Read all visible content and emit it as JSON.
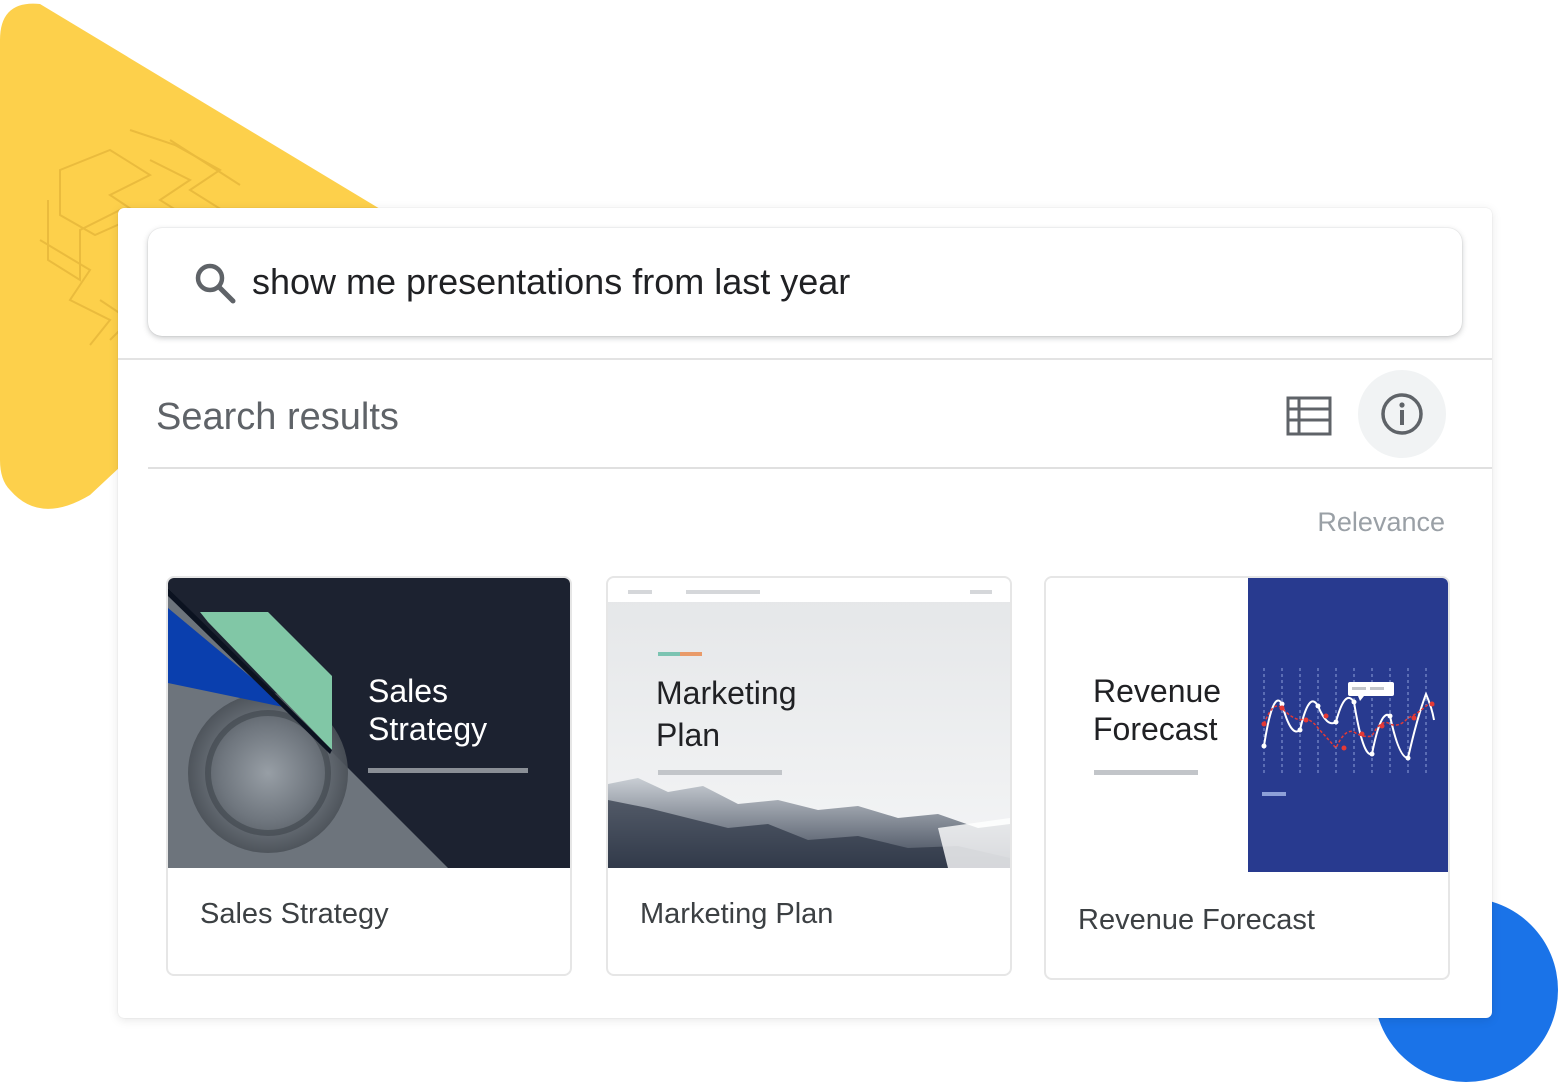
{
  "search": {
    "query": "show me presentations from last year",
    "icon": "search-icon"
  },
  "results": {
    "title": "Search results",
    "sort_label": "Relevance",
    "list_view_icon": "list-view-icon",
    "info_icon": "info-icon"
  },
  "cards": [
    {
      "title": "Sales Strategy",
      "thumb_text": "Sales\nStrategy"
    },
    {
      "title": "Marketing Plan",
      "thumb_text": "Marketing\nPlan"
    },
    {
      "title": "Revenue Forecast",
      "thumb_text": "Revenue\nForecast"
    }
  ],
  "colors": {
    "yellow": "#fdd04b",
    "blue": "#1a73e8",
    "navy": "#283a8f",
    "dark": "#1c2230",
    "green": "#81c7a6",
    "red": "#e53935"
  }
}
